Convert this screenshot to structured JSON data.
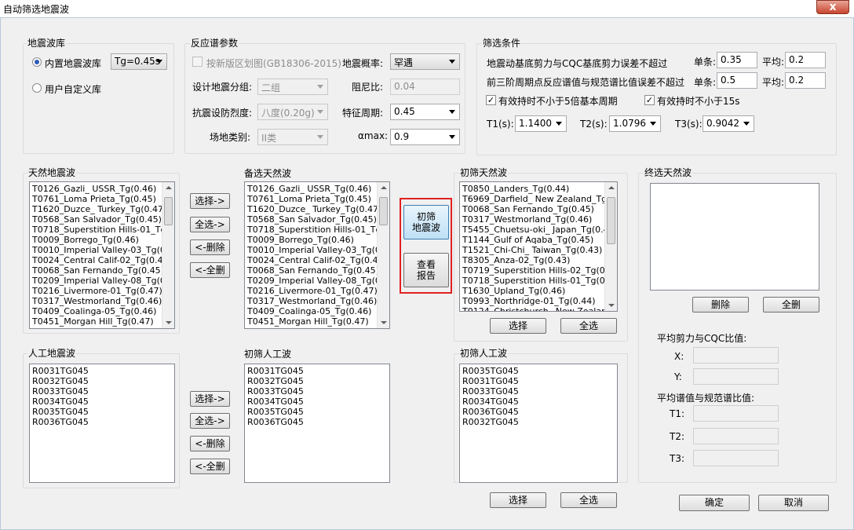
{
  "window": {
    "title": "自动筛选地震波",
    "close_glyph": "x"
  },
  "library": {
    "group_label": "地震波库",
    "builtin_label": "内置地震波库",
    "builtin_selected": true,
    "tg_value": "Tg=0.45s",
    "custom_label": "用户自定义库"
  },
  "spectrum": {
    "group_label": "反应谱参数",
    "new_zoning_label": "按新版区划图(GB18306-2015)",
    "new_zoning_checked": false,
    "probability_label": "地震概率:",
    "probability_value": "罕遇",
    "design_group_label": "设计地震分组:",
    "design_group_value": "二组",
    "damping_label": "阻尼比:",
    "damping_value": "0.04",
    "intensity_label": "抗震设防烈度:",
    "intensity_value": "八度(0.20g)",
    "char_period_label": "特征周期:",
    "char_period_value": "0.45",
    "site_label": "场地类别:",
    "site_value": "II类",
    "amax_label": "αmax:",
    "amax_value": "0.9"
  },
  "filter": {
    "group_label": "筛选条件",
    "shear_label": "地震动基底剪力与CQC基底剪力误差不超过",
    "shear_single_label": "单条:",
    "shear_single_value": "0.35",
    "shear_avg_label": "平均:",
    "shear_avg_value": "0.2",
    "spectrum_label": "前三阶周期点反应谱值与规范谱比值误差不超过",
    "spectrum_single_label": "单条:",
    "spectrum_single_value": "0.5",
    "spectrum_avg_label": "平均:",
    "spectrum_avg_value": "0.2",
    "duration5_label": "有效持时不小于5倍基本周期",
    "duration5_checked": true,
    "duration15_label": "有效持时不小于15s",
    "duration15_checked": true,
    "t1_label": "T1(s):",
    "t1_value": "1.1400",
    "t2_label": "T2(s):",
    "t2_value": "1.0796",
    "t3_label": "T3(s):",
    "t3_value": "0.9042"
  },
  "natural": {
    "label": "天然地震波",
    "items": [
      "T0126_Gazli_ USSR_Tg(0.46)",
      "T0761_Loma Prieta_Tg(0.45)",
      "T1620_Duzce_ Turkey_Tg(0.47)",
      "T0568_San Salvador_Tg(0.45)",
      "T0718_Superstition Hills-01_Tg(0.",
      "T0009_Borrego_Tg(0.46)",
      "T0010_Imperial Valley-03_Tg(0.45",
      "T0024_Central Calif-02_Tg(0.44)",
      "T0068_San Fernando_Tg(0.45)",
      "T0209_Imperial Valley-08_Tg(0.46",
      "T0216_Livermore-01_Tg(0.47)",
      "T0317_Westmorland_Tg(0.46)",
      "T0409_Coalinga-05_Tg(0.46)",
      "T0451_Morgan Hill_Tg(0.47)"
    ]
  },
  "candidate_natural": {
    "label": "备选天然波",
    "items": [
      "T0126_Gazli_ USSR_Tg(0.46)",
      "T0761_Loma Prieta_Tg(0.45)",
      "T1620_Duzce_ Turkey_Tg(0.47)",
      "T0568_San Salvador_Tg(0.45)",
      "T0718_Superstition Hills-01_Tg(0.",
      "T0009_Borrego_Tg(0.46)",
      "T0010_Imperial Valley-03_Tg(0.45",
      "T0024_Central Calif-02_Tg(0.44)",
      "T0068_San Fernando_Tg(0.45)",
      "T0209_Imperial Valley-08_Tg(0.46",
      "T0216_Livermore-01_Tg(0.47)",
      "T0317_Westmorland_Tg(0.46)",
      "T0409_Coalinga-05_Tg(0.46)",
      "T0451_Morgan Hill_Tg(0.47)"
    ]
  },
  "prelim_natural": {
    "label": "初筛天然波",
    "items": [
      "T0850_Landers_Tg(0.44)",
      "T6969_Darfield_ New Zealand_Tg(0.4",
      "T0068_San Fernando_Tg(0.45)",
      "T0317_Westmorland_Tg(0.46)",
      "T5455_Chuetsu-oki_ Japan_Tg(0.45)",
      "T1144_Gulf of Aqaba_Tg(0.45)",
      "T1521_Chi-Chi_ Taiwan_Tg(0.43)",
      "T8305_Anza-02_Tg(0.43)",
      "T0719_Superstition Hills-02_Tg(0.43)",
      "T0718_Superstition Hills-01_Tg(0.46)",
      "T1630_Upland_Tg(0.46)",
      "T0993_Northridge-01_Tg(0.44)",
      "T0124_Christchurch_ New Zealand_T"
    ],
    "select_label": "选择",
    "select_all_label": "全选"
  },
  "final_natural": {
    "label": "终选天然波",
    "delete_label": "删除",
    "delete_all_label": "全删",
    "shear_ratio_label": "平均剪力与CQC比值:",
    "x_label": "X:",
    "y_label": "Y:",
    "spectrum_ratio_label": "平均谱值与规范谱比值:",
    "t1_label": "T1:",
    "t2_label": "T2:",
    "t3_label": "T3:"
  },
  "transfer_natural": {
    "select": "选择->",
    "select_all": "全选->",
    "delete": "<-删除",
    "delete_all": "<-全删"
  },
  "transfer_artificial": {
    "select": "选择->",
    "select_all": "全选->",
    "delete": "<-删除",
    "delete_all": "<-全删"
  },
  "artificial": {
    "label": "人工地震波",
    "items": [
      "R0031TG045",
      "R0032TG045",
      "R0033TG045",
      "R0034TG045",
      "R0035TG045",
      "R0036TG045"
    ]
  },
  "prelim_artificial_mid": {
    "label": "初筛人工波",
    "items": [
      "R0031TG045",
      "R0032TG045",
      "R0033TG045",
      "R0034TG045",
      "R0035TG045",
      "R0036TG045"
    ]
  },
  "prelim_artificial": {
    "label": "初筛人工波",
    "items": [
      "R0035TG045",
      "R0031TG045",
      "R0033TG045",
      "R0034TG045",
      "R0036TG045",
      "R0032TG045"
    ],
    "select_label": "选择",
    "select_all_label": "全选"
  },
  "actions": {
    "prelim_filter_line1": "初筛",
    "prelim_filter_line2": "地震波",
    "view_report_line1": "查看",
    "view_report_line2": "报告",
    "ok": "确定",
    "cancel": "取消",
    "highlight_color": "#e02020"
  }
}
